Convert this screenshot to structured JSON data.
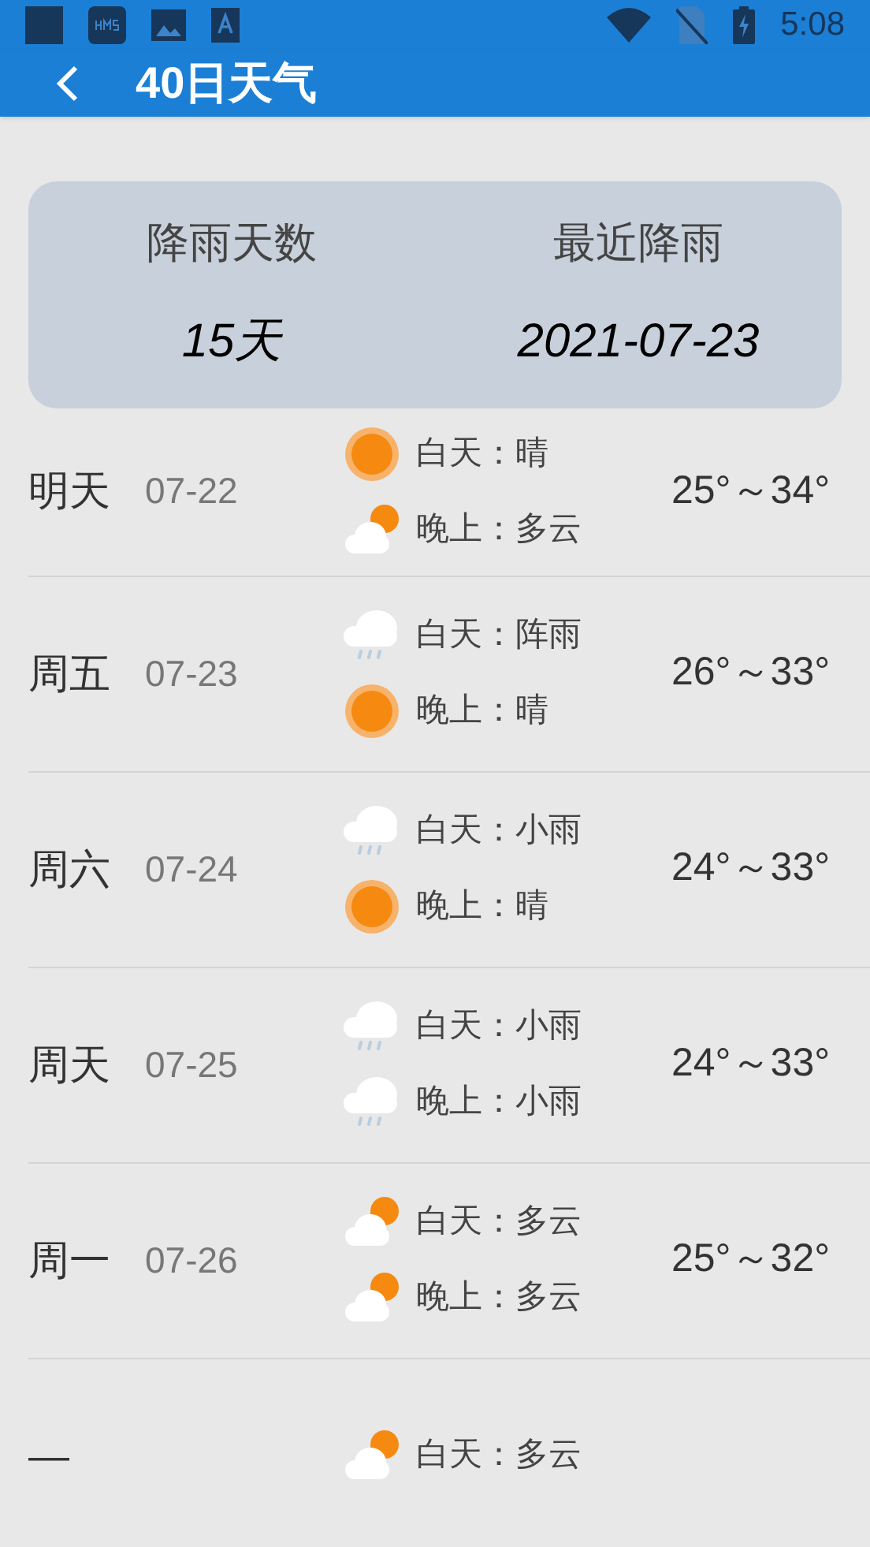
{
  "status_bar": {
    "time": "5:08"
  },
  "app_bar": {
    "title": "40日天气"
  },
  "summary": [
    {
      "label": "降雨天数",
      "value": "15天"
    },
    {
      "label": "最近降雨",
      "value": "2021-07-23"
    }
  ],
  "days": [
    {
      "day": "明天",
      "date": "07-22",
      "parts": [
        {
          "kind": "sun",
          "text": "白天：晴"
        },
        {
          "kind": "partly",
          "text": "晚上：多云"
        }
      ],
      "temp": "25°～34°"
    },
    {
      "day": "周五",
      "date": "07-23",
      "parts": [
        {
          "kind": "rain",
          "text": "白天：阵雨"
        },
        {
          "kind": "sun",
          "text": "晚上：晴"
        }
      ],
      "temp": "26°～33°"
    },
    {
      "day": "周六",
      "date": "07-24",
      "parts": [
        {
          "kind": "rain",
          "text": "白天：小雨"
        },
        {
          "kind": "sun",
          "text": "晚上：晴"
        }
      ],
      "temp": "24°～33°"
    },
    {
      "day": "周天",
      "date": "07-25",
      "parts": [
        {
          "kind": "rain",
          "text": "白天：小雨"
        },
        {
          "kind": "rain",
          "text": "晚上：小雨"
        }
      ],
      "temp": "24°～33°"
    },
    {
      "day": "周一",
      "date": "07-26",
      "parts": [
        {
          "kind": "partly",
          "text": "白天：多云"
        },
        {
          "kind": "partly",
          "text": "晚上：多云"
        }
      ],
      "temp": "25°～32°"
    },
    {
      "day": "—",
      "parts": [
        {
          "kind": "partly",
          "text": "白天：多云"
        }
      ]
    }
  ]
}
